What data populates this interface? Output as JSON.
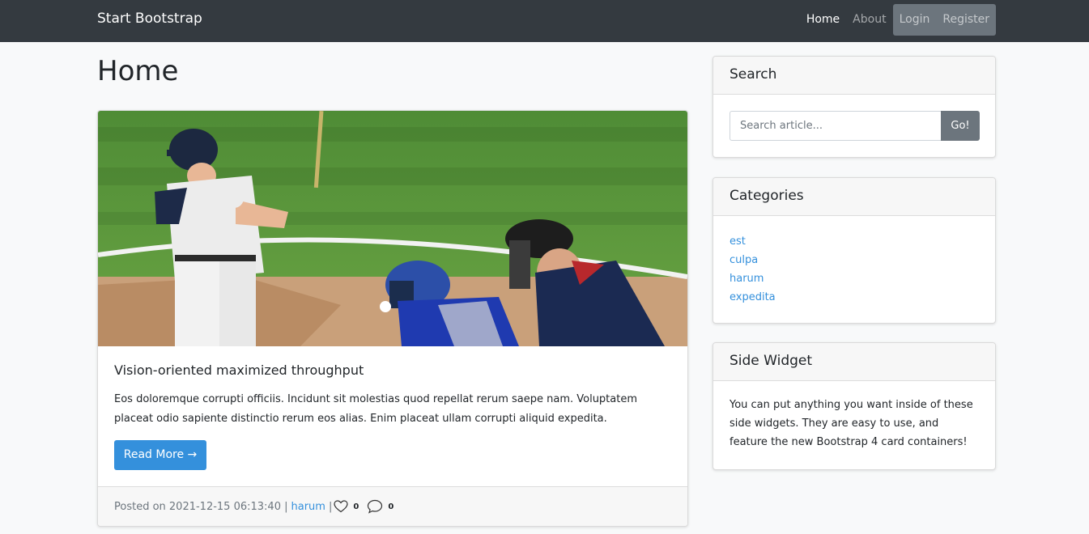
{
  "navbar": {
    "brand": "Start Bootstrap",
    "links": [
      {
        "label": "Home",
        "active": true
      },
      {
        "label": "About",
        "active": false
      }
    ],
    "auth_links": [
      {
        "label": "Login"
      },
      {
        "label": "Register"
      }
    ]
  },
  "main": {
    "page_title": "Home",
    "post": {
      "title": "Vision-oriented maximized throughput",
      "excerpt": "Eos doloremque corrupti officiis. Incidunt sit molestias quod repellat rerum saepe nam. Voluptatem placeat odio sapiente distinctio rerum eos alias. Enim placeat ullam corrupti aliquid expedita.",
      "read_more_label": "Read More →",
      "posted_prefix": "Posted on 2021-12-15 06:13:40 |",
      "author": "harum",
      "separator": "|",
      "likes": "0",
      "comments": "0"
    }
  },
  "sidebar": {
    "search": {
      "title": "Search",
      "placeholder": "Search article...",
      "button_label": "Go!"
    },
    "categories": {
      "title": "Categories",
      "items": [
        "est",
        "culpa",
        "harum",
        "expedita"
      ]
    },
    "side_widget": {
      "title": "Side Widget",
      "text": "You can put anything you want inside of these side widgets. They are easy to use, and feature the new Bootstrap 4 card containers!"
    }
  },
  "colors": {
    "navbar_bg": "#343a40",
    "primary": "#3490dc",
    "secondary": "#6c757d",
    "page_bg": "#f8f9fa"
  },
  "icons": [
    "heart-icon",
    "comment-icon"
  ]
}
